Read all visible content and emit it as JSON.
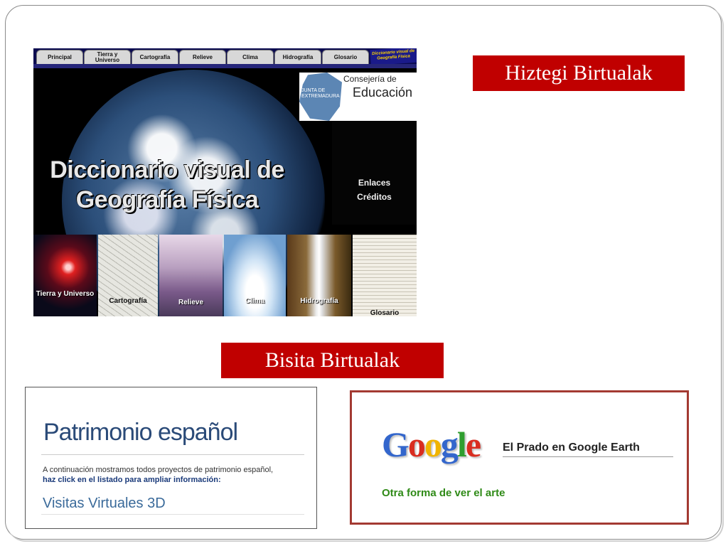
{
  "slide": {
    "hiztegi_label": "Hiztegi Birtualak",
    "bisita_label": "Bisita Birtualak"
  },
  "dictionary": {
    "nav_tabs": [
      "Principal",
      "Tierra y Universo",
      "Cartografía",
      "Relieve",
      "Clima",
      "Hidrografía",
      "Glosario"
    ],
    "nav_logo": "Diccionario visual de Geografía Física",
    "consejeria_line1": "Consejería de",
    "consejeria_line2": "Educación",
    "junta": "JUNTA DE EXTREMADURA",
    "title_line1": "Diccionario visual de",
    "title_line2": "Geografía Física",
    "side_links": [
      "Enlaces",
      "Créditos"
    ],
    "thumbs": [
      "Tierra y Universo",
      "Cartografía",
      "Relieve",
      "Clima",
      "Hidrografía",
      "Glosario"
    ]
  },
  "patrimonio": {
    "title": "Patrimonio español",
    "line1": "A continuación mostramos todos proyectos de patrimonio español,",
    "line2": "haz click en el listado para ampliar información:",
    "visitas": "Visitas Virtuales 3D"
  },
  "google": {
    "logo_letters": [
      "G",
      "o",
      "o",
      "g",
      "l",
      "e"
    ],
    "logo_colors": [
      "#3366cc",
      "#d92d20",
      "#f0b400",
      "#3366cc",
      "#2f9e2f",
      "#d92d20"
    ],
    "prado": "El Prado en Google Earth",
    "otra": "Otra forma de ver el arte"
  }
}
